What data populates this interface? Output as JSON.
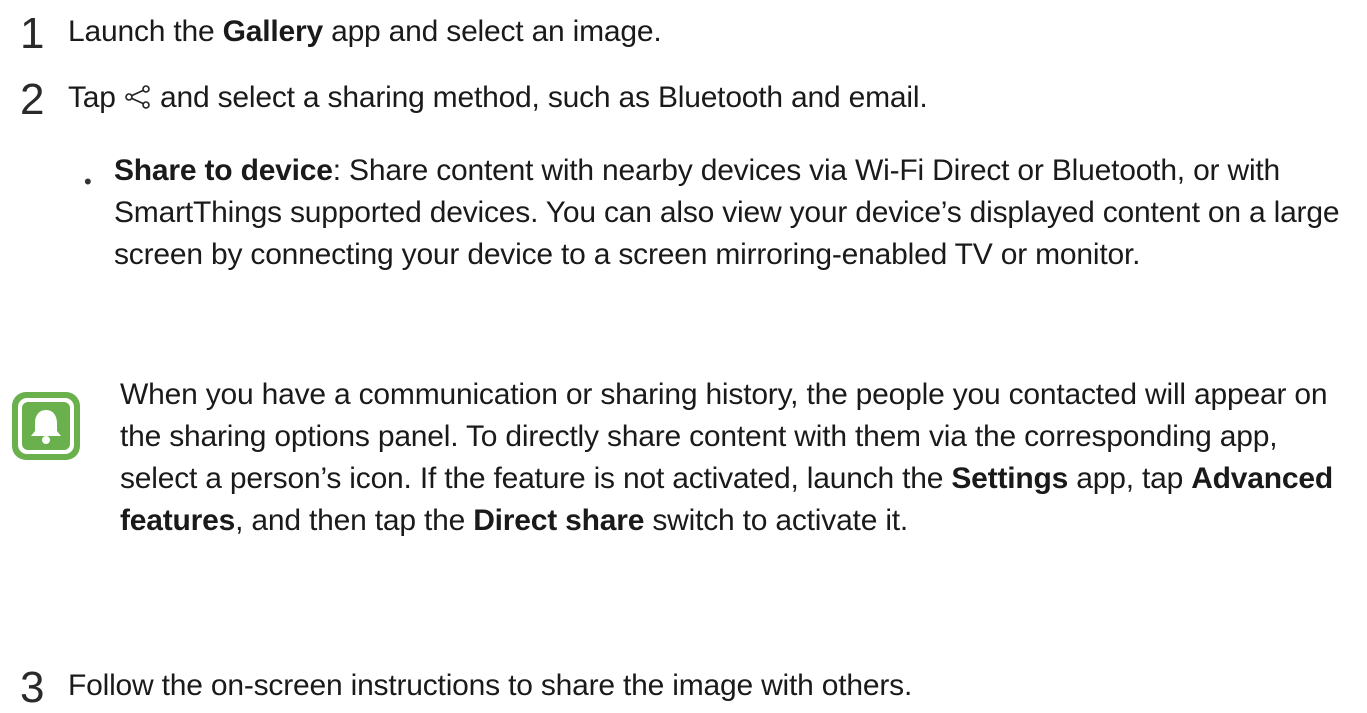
{
  "steps": [
    {
      "number": "1",
      "pre": "Launch the ",
      "bold": "Gallery",
      "post": " app and select an image."
    },
    {
      "number": "2",
      "pre": "Tap ",
      "icon": "share-icon",
      "post": " and select a sharing method, such as Bluetooth and email."
    },
    {
      "number": "3",
      "text": "Follow the on-screen instructions to share the image with others."
    }
  ],
  "bullet": {
    "marker": "•",
    "title": "Share to device",
    "text": ": Share content with nearby devices via Wi-Fi Direct or Bluetooth, or with SmartThings supported devices. You can also view your device’s displayed content on a large screen by connecting your device to a screen mirroring-enabled TV or monitor."
  },
  "note": {
    "icon": "bell-icon",
    "icon_color": "#6ab04c",
    "t1": "When you have a communication or sharing history, the people you contacted will appear on the sharing options panel. To directly share content with them via the corresponding app, select a person’s icon. If the feature is not activated, launch the ",
    "b1": "Settings",
    "t2": " app, tap ",
    "b2": "Advanced features",
    "t3": ", and then tap the ",
    "b3": "Direct share",
    "t4": " switch to activate it."
  }
}
